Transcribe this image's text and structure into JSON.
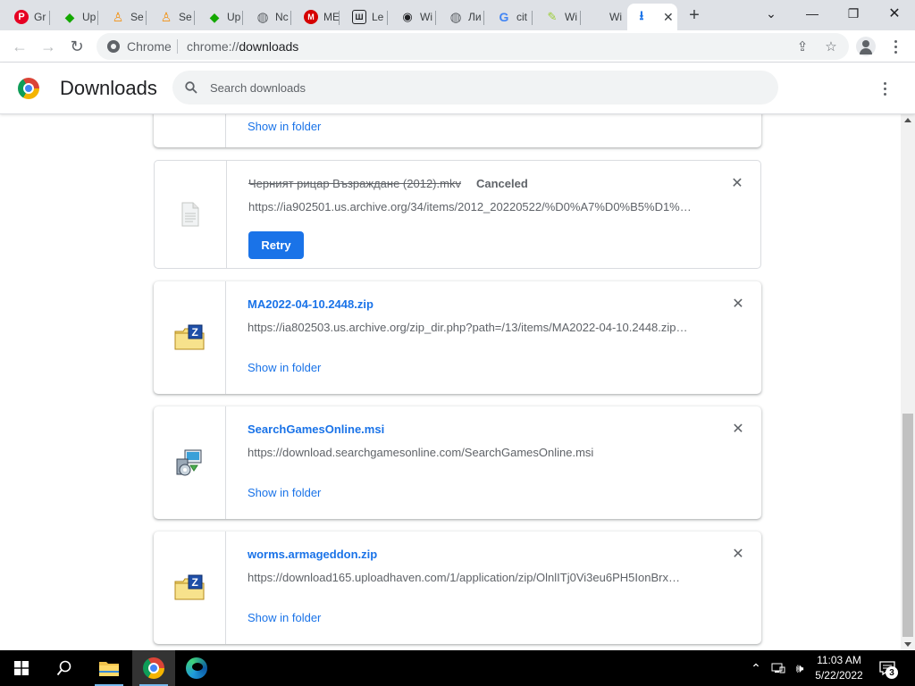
{
  "tabs": [
    {
      "label": "Gr",
      "favicon": "pinterest-icon",
      "color": "#e60023"
    },
    {
      "label": "Up",
      "favicon": "upwork-icon",
      "color": "#14a800"
    },
    {
      "label": "Se",
      "favicon": "person-icon",
      "color": "#f29111"
    },
    {
      "label": "Se",
      "favicon": "person-icon",
      "color": "#f29111"
    },
    {
      "label": "Up",
      "favicon": "upwork-icon",
      "color": "#14a800"
    },
    {
      "label": "Nc",
      "favicon": "globe-icon",
      "color": "#5f6368"
    },
    {
      "label": "ME",
      "favicon": "m-icon",
      "color": "#d50000"
    },
    {
      "label": "Le",
      "favicon": "library-icon",
      "color": "#202124"
    },
    {
      "label": "Wi",
      "favicon": "eye-icon",
      "color": "#202124"
    },
    {
      "label": "Ли",
      "favicon": "globe-icon",
      "color": "#5f6368"
    },
    {
      "label": "cit",
      "favicon": "google-icon",
      "color": "#4285f4"
    },
    {
      "label": "Wi",
      "favicon": "pencil-icon",
      "color": "#9acd32"
    },
    {
      "label": "Wi",
      "favicon": "windows-icon",
      "color": "#00a4ef"
    }
  ],
  "active_tab": {
    "favicon": "download-icon",
    "close": "✕"
  },
  "omnibox": {
    "chip": "Chrome",
    "url_scheme": "chrome://",
    "url_path": "downloads"
  },
  "header": {
    "title": "Downloads",
    "search_placeholder": "Search downloads"
  },
  "partial_card": {
    "show_in_folder": "Show in folder"
  },
  "downloads": [
    {
      "filename": "Черният рицар Възраждане (2012).mkv",
      "status": "Canceled",
      "url": "https://ia902501.us.archive.org/34/items/2012_20220522/%D0%A7%D0%B5%D1%8…",
      "action": "Retry",
      "icon": "generic-file-icon"
    },
    {
      "filename": "MA2022-04-10.2448.zip",
      "url": "https://ia802503.us.archive.org/zip_dir.php?path=/13/items/MA2022-04-10.2448.zip…",
      "action": "Show in folder",
      "icon": "zip-folder-icon"
    },
    {
      "filename": "SearchGamesOnline.msi",
      "url": "https://download.searchgamesonline.com/SearchGamesOnline.msi",
      "action": "Show in folder",
      "icon": "installer-icon"
    },
    {
      "filename": "worms.armageddon.zip",
      "url": "https://download165.uploadhaven.com/1/application/zip/OlnlITj0Vi3eu6PH5IonBrx…",
      "action": "Show in folder",
      "icon": "zip-folder-icon"
    }
  ],
  "taskbar": {
    "time": "11:03 AM",
    "date": "5/22/2022",
    "notification_count": "3"
  },
  "colors": {
    "accent": "#1a73e8",
    "tabstrip": "#dee1e6",
    "taskbar": "#000000"
  }
}
